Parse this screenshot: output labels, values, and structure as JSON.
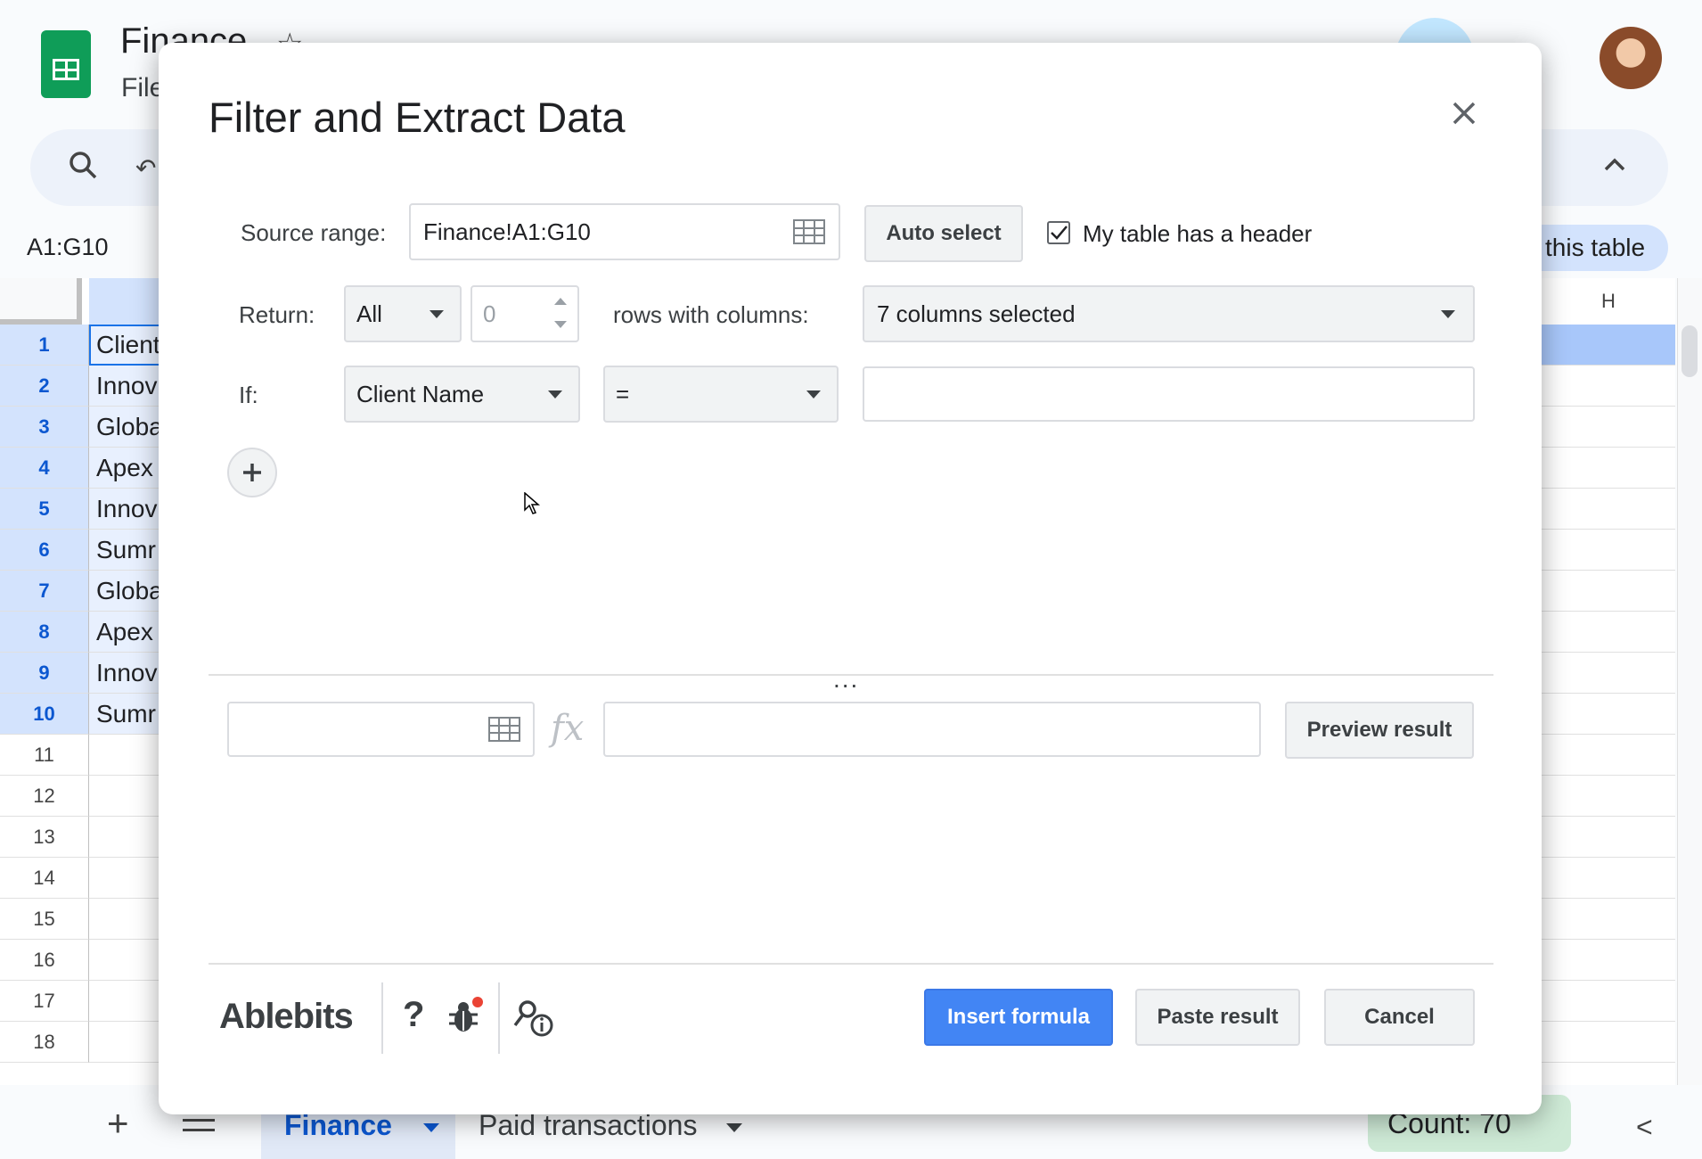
{
  "app": {
    "doc_title": "Finance",
    "menu_file": "File",
    "namebox": "A1:G10",
    "this_table_chip": "this table",
    "column_h": "H",
    "rows": [
      {
        "num": "1",
        "cell": "Client",
        "selected": true
      },
      {
        "num": "2",
        "cell": "Innov",
        "selected": true
      },
      {
        "num": "3",
        "cell": "Globa",
        "selected": true
      },
      {
        "num": "4",
        "cell": "Apex",
        "selected": true
      },
      {
        "num": "5",
        "cell": "Innov",
        "selected": true
      },
      {
        "num": "6",
        "cell": "Sumr",
        "selected": true
      },
      {
        "num": "7",
        "cell": "Globa",
        "selected": true
      },
      {
        "num": "8",
        "cell": "Apex",
        "selected": true
      },
      {
        "num": "9",
        "cell": "Innov",
        "selected": true
      },
      {
        "num": "10",
        "cell": "Sumr",
        "selected": true
      },
      {
        "num": "11",
        "cell": "",
        "selected": false
      },
      {
        "num": "12",
        "cell": "",
        "selected": false
      },
      {
        "num": "13",
        "cell": "",
        "selected": false
      },
      {
        "num": "14",
        "cell": "",
        "selected": false
      },
      {
        "num": "15",
        "cell": "",
        "selected": false
      },
      {
        "num": "16",
        "cell": "",
        "selected": false
      },
      {
        "num": "17",
        "cell": "",
        "selected": false
      },
      {
        "num": "18",
        "cell": "",
        "selected": false
      }
    ],
    "sheet_tabs": {
      "add": "+",
      "finance": "Finance",
      "paid": "Paid transactions"
    },
    "count_chip": "Count: 70",
    "collapse": "<"
  },
  "dialog": {
    "title": "Filter and Extract Data",
    "source_label": "Source range:",
    "source_value": "Finance!A1:G10",
    "auto_select": "Auto select",
    "header_checkbox_label": "My table has a header",
    "header_checked": true,
    "return_label": "Return:",
    "return_value": "All",
    "count_value": "0",
    "rows_with_columns": "rows with columns:",
    "columns_value": "7 columns selected",
    "if_label": "If:",
    "if_column": "Client Name",
    "if_operator": "=",
    "if_value": "",
    "result_range": "",
    "formula_value": "",
    "fx": "fx",
    "more_dots": "...",
    "preview": "Preview result",
    "brand": "Ablebits",
    "help": "?",
    "insert_formula": "Insert formula",
    "paste_result": "Paste result",
    "cancel": "Cancel"
  },
  "colors": {
    "accent_blue": "#4285f4",
    "selection_blue": "#d3e3fd",
    "sheets_green": "#0f9d58",
    "count_green": "#ceead6",
    "bug_dot": "#ea4335"
  },
  "icons": [
    "star-icon",
    "folder-icon",
    "search-icon",
    "undo-icon",
    "chevron-up-icon",
    "grid-range-icon",
    "close-icon",
    "checkbox-icon",
    "plus-icon",
    "bug-icon",
    "key-info-icon",
    "cursor-icon"
  ]
}
